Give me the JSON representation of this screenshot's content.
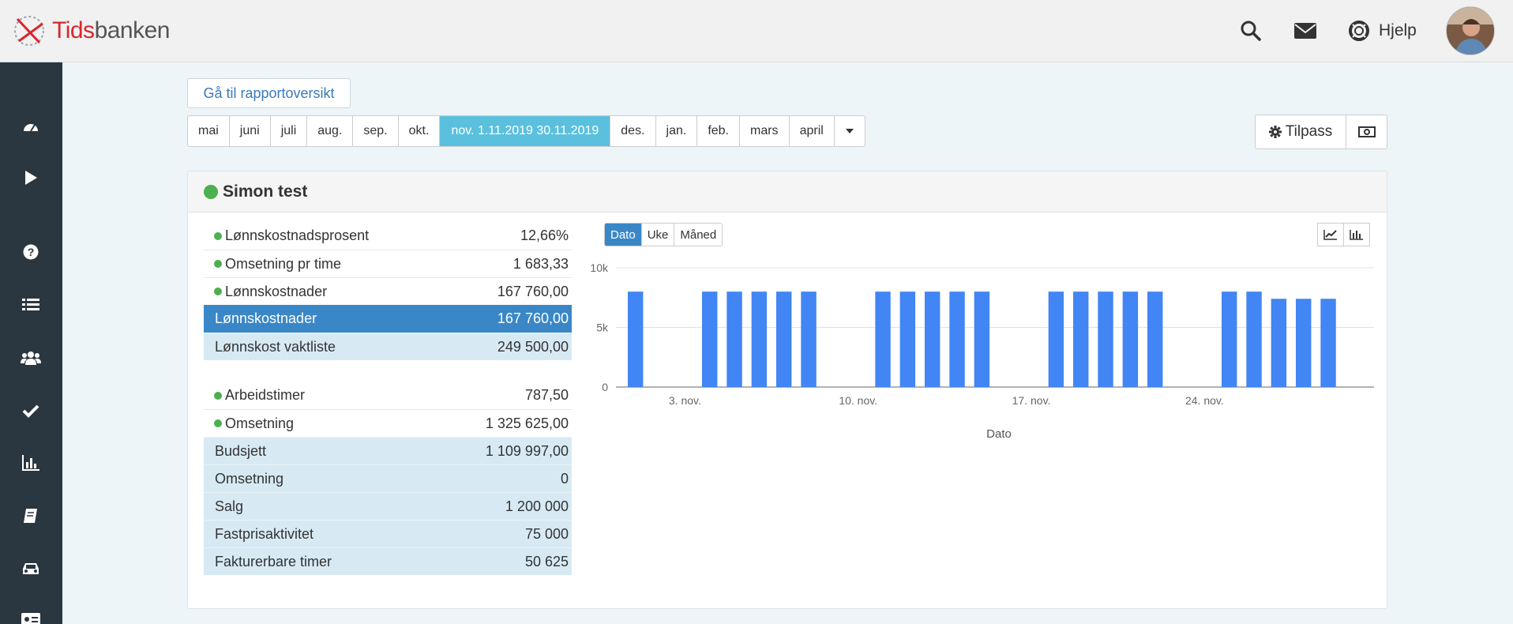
{
  "app": {
    "logo_part1": "Tids",
    "logo_part2": "banken",
    "help_label": "Hjelp"
  },
  "icons": {
    "topbar": [
      "search-icon",
      "mail-icon",
      "lifebuoy-icon"
    ],
    "sidebar": [
      "dashboard-icon",
      "play-icon",
      "question-icon",
      "list-icon",
      "users-icon",
      "check-icon",
      "bar-chart-icon",
      "book-icon",
      "car-icon",
      "id-card-icon"
    ]
  },
  "report_button": "Gå til rapportoversikt",
  "months": [
    "mai",
    "juni",
    "juli",
    "aug.",
    "sep.",
    "okt.",
    "nov. 1.11.2019 30.11.2019",
    "des.",
    "jan.",
    "feb.",
    "mars",
    "april"
  ],
  "active_month_index": 6,
  "tilpass_label": "Tilpass",
  "panel": {
    "title": "Simon test",
    "kpis_top": [
      {
        "label": "Lønnskostnadsprosent",
        "value": "12,66%",
        "style": "dot"
      },
      {
        "label": "Omsetning pr time",
        "value": "1 683,33",
        "style": "dot"
      },
      {
        "label": "Lønnskostnader",
        "value": "167 760,00",
        "style": "dot"
      },
      {
        "label": "Lønnskostnader",
        "value": "167 760,00",
        "style": "highlight"
      },
      {
        "label": "Lønnskost vaktliste",
        "value": "249 500,00",
        "style": "light"
      }
    ],
    "kpis_bottom": [
      {
        "label": "Arbeidstimer",
        "value": "787,50",
        "style": "dot"
      },
      {
        "label": "Omsetning",
        "value": "1 325 625,00",
        "style": "dot"
      },
      {
        "label": "Budsjett",
        "value": "1 109 997,00",
        "style": "light"
      },
      {
        "label": "Omsetning",
        "value": "0",
        "style": "light"
      },
      {
        "label": "Salg",
        "value": "1 200 000",
        "style": "light"
      },
      {
        "label": "Fastprisaktivitet",
        "value": "75 000",
        "style": "light"
      },
      {
        "label": "Fakturerbare timer",
        "value": "50 625",
        "style": "light"
      }
    ],
    "view_buttons": [
      "Dato",
      "Uke",
      "Måned"
    ],
    "active_view": "Dato",
    "chart_type_buttons": [
      "line-chart-icon",
      "bar-chart-icon"
    ]
  },
  "colors": {
    "bar": "#4285f4",
    "highlight": "#3a87c8",
    "active_month": "#5bc0de",
    "status_dot": "#4caf50"
  },
  "chart_data": {
    "type": "bar",
    "xlabel": "Dato",
    "ylabel": "",
    "ylim": [
      0,
      10000
    ],
    "yticks": [
      "0",
      "5k",
      "10k"
    ],
    "xticks": [
      {
        "day": 3,
        "label": "3. nov."
      },
      {
        "day": 10,
        "label": "10. nov."
      },
      {
        "day": 17,
        "label": "17. nov."
      },
      {
        "day": 24,
        "label": "24. nov."
      }
    ],
    "x": [
      1,
      2,
      3,
      4,
      5,
      6,
      7,
      8,
      9,
      10,
      11,
      12,
      13,
      14,
      15,
      16,
      17,
      18,
      19,
      20,
      21,
      22,
      23,
      24,
      25,
      26,
      27,
      28,
      29,
      30
    ],
    "values": [
      8000,
      0,
      0,
      8000,
      8000,
      8000,
      8000,
      8000,
      0,
      0,
      8000,
      8000,
      8000,
      8000,
      8000,
      0,
      0,
      8000,
      8000,
      8000,
      8000,
      8000,
      0,
      0,
      8000,
      8000,
      7400,
      7400,
      7400,
      0
    ]
  }
}
